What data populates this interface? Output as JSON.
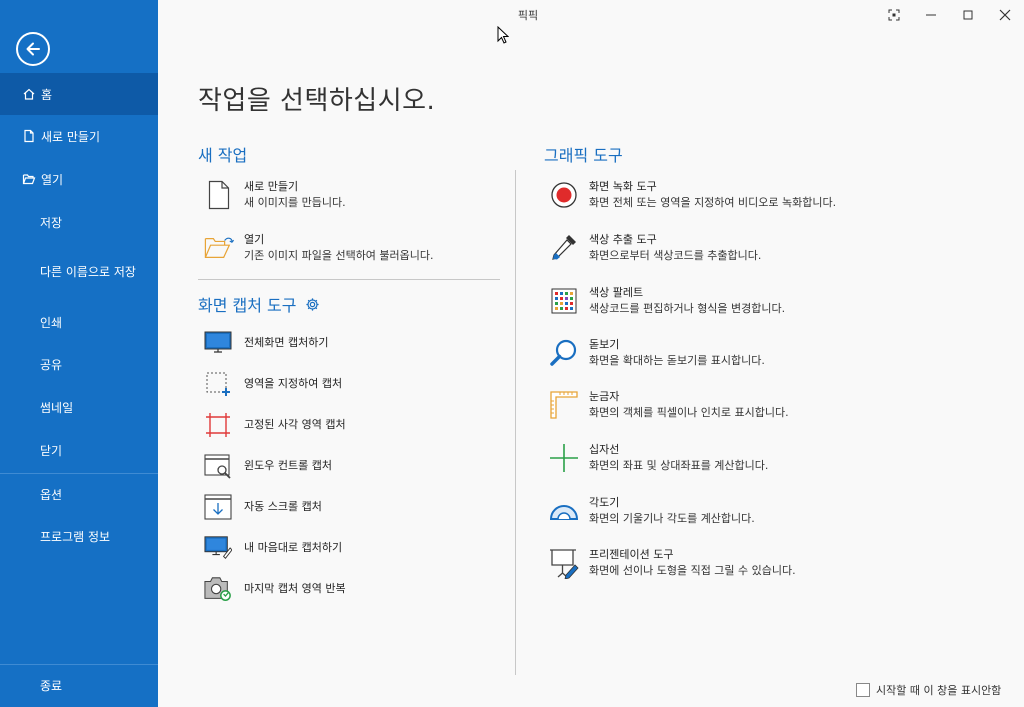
{
  "app": {
    "title": "픽픽"
  },
  "sidebar": {
    "items": [
      {
        "label": "홈"
      },
      {
        "label": "새로 만들기"
      },
      {
        "label": "열기"
      },
      {
        "label": "저장"
      },
      {
        "label": "다른 이름으로 저장"
      },
      {
        "label": "인쇄"
      },
      {
        "label": "공유"
      },
      {
        "label": "썸네일"
      },
      {
        "label": "닫기"
      },
      {
        "label": "옵션"
      },
      {
        "label": "프로그램 정보"
      },
      {
        "label": "종료"
      }
    ]
  },
  "main": {
    "title": "작업을 선택하십시오.",
    "new_task": {
      "title": "새 작업",
      "items": [
        {
          "title": "새로 만들기",
          "desc": "새 이미지를 만듭니다."
        },
        {
          "title": "열기",
          "desc": "기존 이미지 파일을 선택하여 불러옵니다."
        }
      ]
    },
    "capture": {
      "title": "화면 캡처 도구",
      "items": [
        {
          "label": "전체화면 캡처하기"
        },
        {
          "label": "영역을 지정하여 캡처"
        },
        {
          "label": "고정된 사각 영역 캡처"
        },
        {
          "label": "윈도우 컨트롤 캡처"
        },
        {
          "label": "자동 스크롤 캡처"
        },
        {
          "label": "내 마음대로 캡처하기"
        },
        {
          "label": "마지막 캡처 영역 반복"
        }
      ]
    },
    "graphic": {
      "title": "그래픽 도구",
      "items": [
        {
          "title": "화면 녹화 도구",
          "desc": "화면 전체 또는 영역을 지정하여 비디오로 녹화합니다."
        },
        {
          "title": "색상 추출 도구",
          "desc": "화면으로부터 색상코드를 추출합니다."
        },
        {
          "title": "색상 팔레트",
          "desc": "색상코드를 편집하거나 형식을 변경합니다."
        },
        {
          "title": "돋보기",
          "desc": "화면을 확대하는 돋보기를 표시합니다."
        },
        {
          "title": "눈금자",
          "desc": "화면의 객체를 픽셀이나 인치로 표시합니다."
        },
        {
          "title": "십자선",
          "desc": "화면의 좌표 및 상대좌표를 계산합니다."
        },
        {
          "title": "각도기",
          "desc": "화면의 기울기나 각도를 계산합니다."
        },
        {
          "title": "프리젠테이션 도구",
          "desc": "화면에 선이나 도형을 직접 그릴 수 있습니다."
        }
      ]
    },
    "footer": {
      "checkbox_label": "시작할 때 이 창을 표시안함"
    }
  },
  "colors": {
    "sidebar": "#1570c5",
    "sidebar_active": "#0e5aa7",
    "accent": "#1a6fc1"
  }
}
